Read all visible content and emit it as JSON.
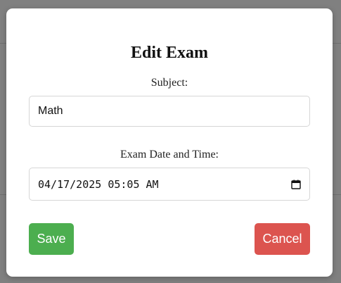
{
  "modal": {
    "title": "Edit Exam",
    "subject": {
      "label": "Subject:",
      "value": "Math"
    },
    "exam_datetime": {
      "label": "Exam Date and Time:",
      "value": "04/17/2025 05:05 AM"
    },
    "buttons": {
      "save": "Save",
      "cancel": "Cancel"
    }
  },
  "colors": {
    "save": "#4cae4f",
    "cancel": "#dc544f",
    "overlay": "#808080"
  },
  "icons": {
    "date_picker": "calendar-icon"
  }
}
